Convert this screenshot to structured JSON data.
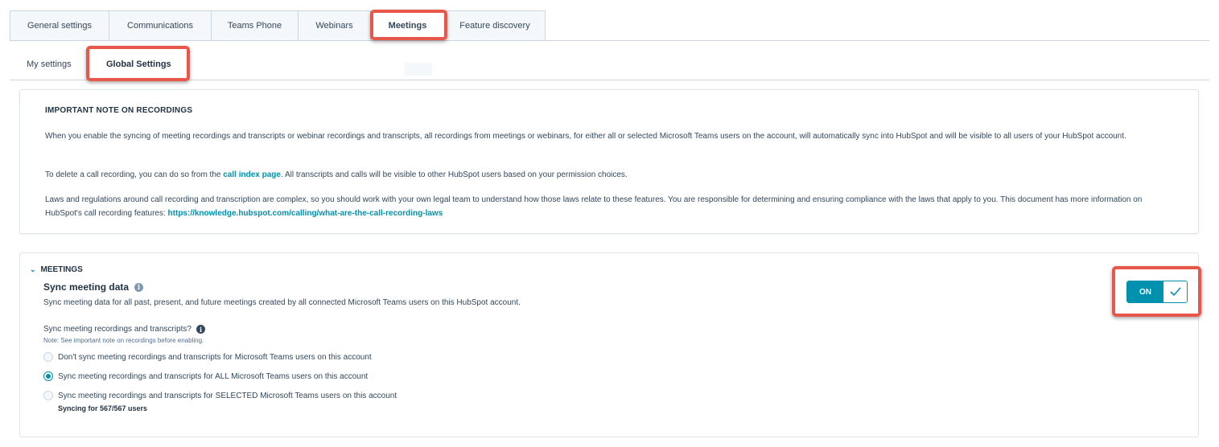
{
  "tabs": [
    {
      "label": "General settings"
    },
    {
      "label": "Communications"
    },
    {
      "label": "Teams Phone"
    },
    {
      "label": "Webinars"
    },
    {
      "label": "Meetings"
    },
    {
      "label": "Feature discovery"
    }
  ],
  "subtabs": [
    {
      "label": "My settings"
    },
    {
      "label": "Global Settings"
    }
  ],
  "note": {
    "title": "IMPORTANT NOTE ON RECORDINGS",
    "p1": "When you enable the syncing of meeting recordings and transcripts or webinar recordings and transcripts, all recordings from meetings or webinars, for either all or selected Microsoft Teams users on the account, will automatically sync into HubSpot and will be visible to all users of your HubSpot account.",
    "p2_before": "To delete a call recording, you can do so from the ",
    "p2_link": "call index page",
    "p2_after": ". All transcripts and calls will be visible to other HubSpot users based on your permission choices.",
    "p3_before": "Laws and regulations around call recording and transcription are complex, so you should work with your own legal team to understand how those laws relate to these features. You are responsible for determining and ensuring compliance with the laws that apply to you. This document has more information on HubSpot's call recording features: ",
    "p3_link": "https://knowledge.hubspot.com/calling/what-are-the-call-recording-laws"
  },
  "meetings": {
    "section_title": "MEETINGS",
    "sync_title": "Sync meeting data",
    "sync_desc": "Sync meeting data for all past, present, and future meetings created by all connected Microsoft Teams users on this HubSpot account.",
    "toggle_label": "ON",
    "question": "Sync meeting recordings and transcripts?",
    "question_note": "Note: See important note on recordings before enabling.",
    "options": [
      {
        "label": "Don't sync meeting recordings and transcripts for Microsoft Teams users on this account",
        "selected": false
      },
      {
        "label": "Sync meeting recordings and transcripts for ALL Microsoft Teams users on this account",
        "selected": true
      },
      {
        "label": "Sync meeting recordings and transcripts for SELECTED Microsoft Teams users on this account",
        "selected": false
      }
    ],
    "syncing_count": "Syncing for 567/567 users"
  },
  "colors": {
    "accent": "#0091ae",
    "highlight": "#e8574a"
  }
}
